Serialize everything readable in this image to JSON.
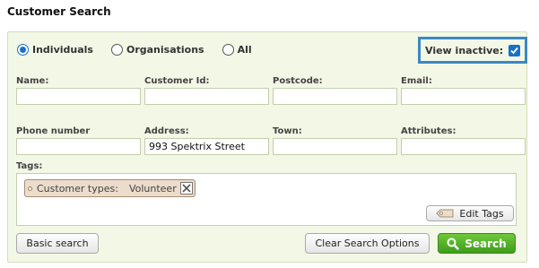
{
  "page_title": "Customer Search",
  "customer_type": {
    "options": [
      {
        "label": "Individuals",
        "checked": true
      },
      {
        "label": "Organisations",
        "checked": false
      },
      {
        "label": "All",
        "checked": false
      }
    ]
  },
  "view_inactive": {
    "label": "View inactive:",
    "checked": true
  },
  "fields": {
    "name": {
      "label": "Name:",
      "value": ""
    },
    "customer_id": {
      "label": "Customer Id:",
      "value": ""
    },
    "postcode": {
      "label": "Postcode:",
      "value": ""
    },
    "email": {
      "label": "Email:",
      "value": ""
    },
    "phone": {
      "label": "Phone number",
      "value": ""
    },
    "address": {
      "label": "Address:",
      "value": "993 Spektrix Street"
    },
    "town": {
      "label": "Town:",
      "value": ""
    },
    "attributes": {
      "label": "Attributes:",
      "value": ""
    }
  },
  "tags": {
    "label": "Tags:",
    "items": [
      {
        "type": "Customer types:",
        "value": "Volunteer"
      }
    ],
    "edit_label": "Edit Tags"
  },
  "buttons": {
    "basic_search": "Basic search",
    "clear": "Clear Search Options",
    "search": "Search"
  },
  "colors": {
    "panel_bg": "#f2f7e6",
    "highlight_border": "#3b88c3",
    "search_green": "#4caf25",
    "accent_blue": "#1a6fc9"
  }
}
